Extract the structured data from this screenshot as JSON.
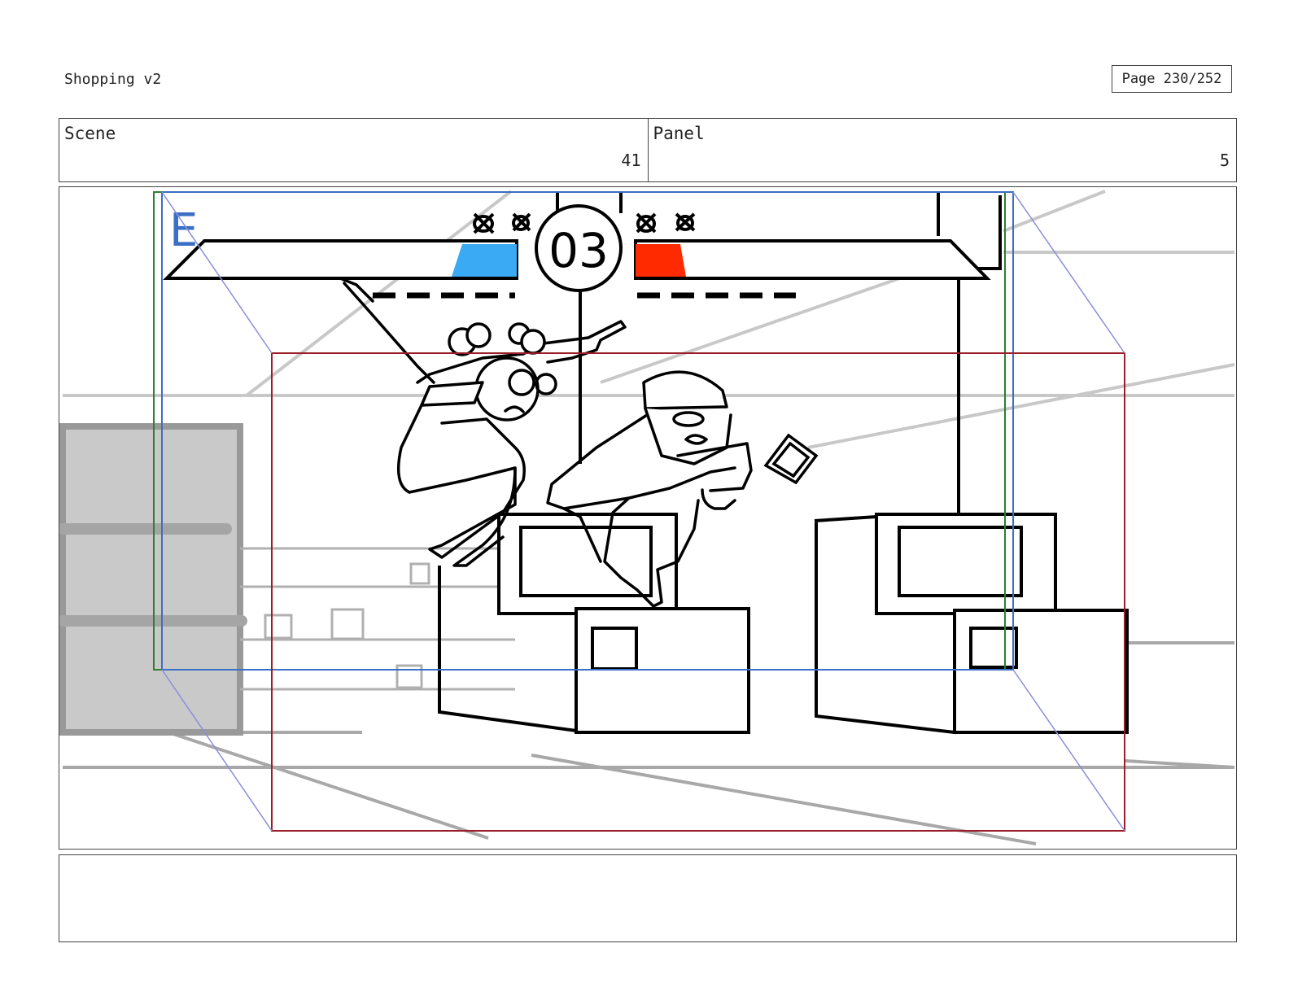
{
  "document": {
    "title": "Shopping v2",
    "page_label": "Page 230/252"
  },
  "info": {
    "scene_label": "Scene",
    "scene_number": "41",
    "panel_label": "Panel",
    "panel_number": "5"
  },
  "frame": {
    "corner_letter": "E",
    "hud_counter": "03",
    "colors": {
      "left_meter": "#3aaaf5",
      "right_meter": "#ff2a00",
      "safe_frame_green": "#2e7d32",
      "safe_frame_blue": "#3b6fc4",
      "camera_frame_red": "#9c1c28",
      "guide_arrows": "#8a8ed8"
    }
  },
  "notes": {
    "text": ""
  }
}
